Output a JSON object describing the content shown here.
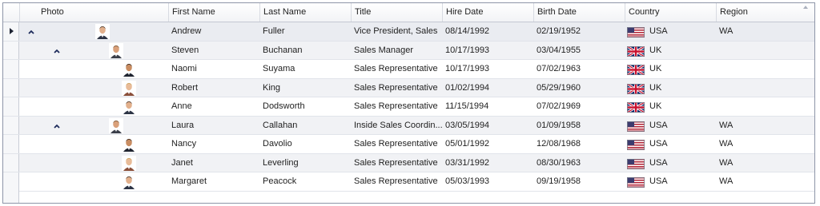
{
  "columns": [
    "Photo",
    "First Name",
    "Last Name",
    "Title",
    "Hire Date",
    "Birth Date",
    "Country",
    "Region"
  ],
  "rows": [
    {
      "level": 0,
      "expandable": true,
      "current": true,
      "first": "Andrew",
      "last": "Fuller",
      "title": "Vice President, Sales",
      "hire": "08/14/1992",
      "birth": "02/19/1952",
      "country": "USA",
      "flag": "us-flag-icon",
      "region": "WA"
    },
    {
      "level": 1,
      "expandable": true,
      "current": false,
      "first": "Steven",
      "last": "Buchanan",
      "title": "Sales Manager",
      "hire": "10/17/1993",
      "birth": "03/04/1955",
      "country": "UK",
      "flag": "uk-flag-icon",
      "region": ""
    },
    {
      "level": 2,
      "expandable": false,
      "current": false,
      "first": "Naomi",
      "last": "Suyama",
      "title": "Sales Representative",
      "hire": "10/17/1993",
      "birth": "07/02/1963",
      "country": "UK",
      "flag": "uk-flag-icon",
      "region": ""
    },
    {
      "level": 2,
      "expandable": false,
      "current": false,
      "first": "Robert",
      "last": "King",
      "title": "Sales Representative",
      "hire": "01/02/1994",
      "birth": "05/29/1960",
      "country": "UK",
      "flag": "uk-flag-icon",
      "region": ""
    },
    {
      "level": 2,
      "expandable": false,
      "current": false,
      "first": "Anne",
      "last": "Dodsworth",
      "title": "Sales Representative",
      "hire": "11/15/1994",
      "birth": "07/02/1969",
      "country": "UK",
      "flag": "uk-flag-icon",
      "region": ""
    },
    {
      "level": 1,
      "expandable": true,
      "current": false,
      "first": "Laura",
      "last": "Callahan",
      "title": "Inside Sales Coordin...",
      "hire": "03/05/1994",
      "birth": "01/09/1958",
      "country": "USA",
      "flag": "us-flag-icon",
      "region": "WA"
    },
    {
      "level": 2,
      "expandable": false,
      "current": false,
      "first": "Nancy",
      "last": "Davolio",
      "title": "Sales Representative",
      "hire": "05/01/1992",
      "birth": "12/08/1968",
      "country": "USA",
      "flag": "us-flag-icon",
      "region": "WA"
    },
    {
      "level": 2,
      "expandable": false,
      "current": false,
      "first": "Janet",
      "last": "Leverling",
      "title": "Sales Representative",
      "hire": "03/31/1992",
      "birth": "08/30/1963",
      "country": "USA",
      "flag": "us-flag-icon",
      "region": "WA"
    },
    {
      "level": 2,
      "expandable": false,
      "current": false,
      "first": "Margaret",
      "last": "Peacock",
      "title": "Sales Representative",
      "hire": "05/03/1993",
      "birth": "09/19/1958",
      "country": "USA",
      "flag": "us-flag-icon",
      "region": "WA"
    }
  ],
  "icons": {
    "row_indicator": "current-row-arrow-icon",
    "expander": "collapse-chevron-icon",
    "photo": "employee-photo",
    "column_chooser": "column-grip-icon",
    "sort": "sort-ascending-icon"
  },
  "colors": {
    "border": "#8e95a8",
    "alt_row": "#f1f2f5",
    "text": "#1f1f1f",
    "accent": "#1d2b5b"
  }
}
